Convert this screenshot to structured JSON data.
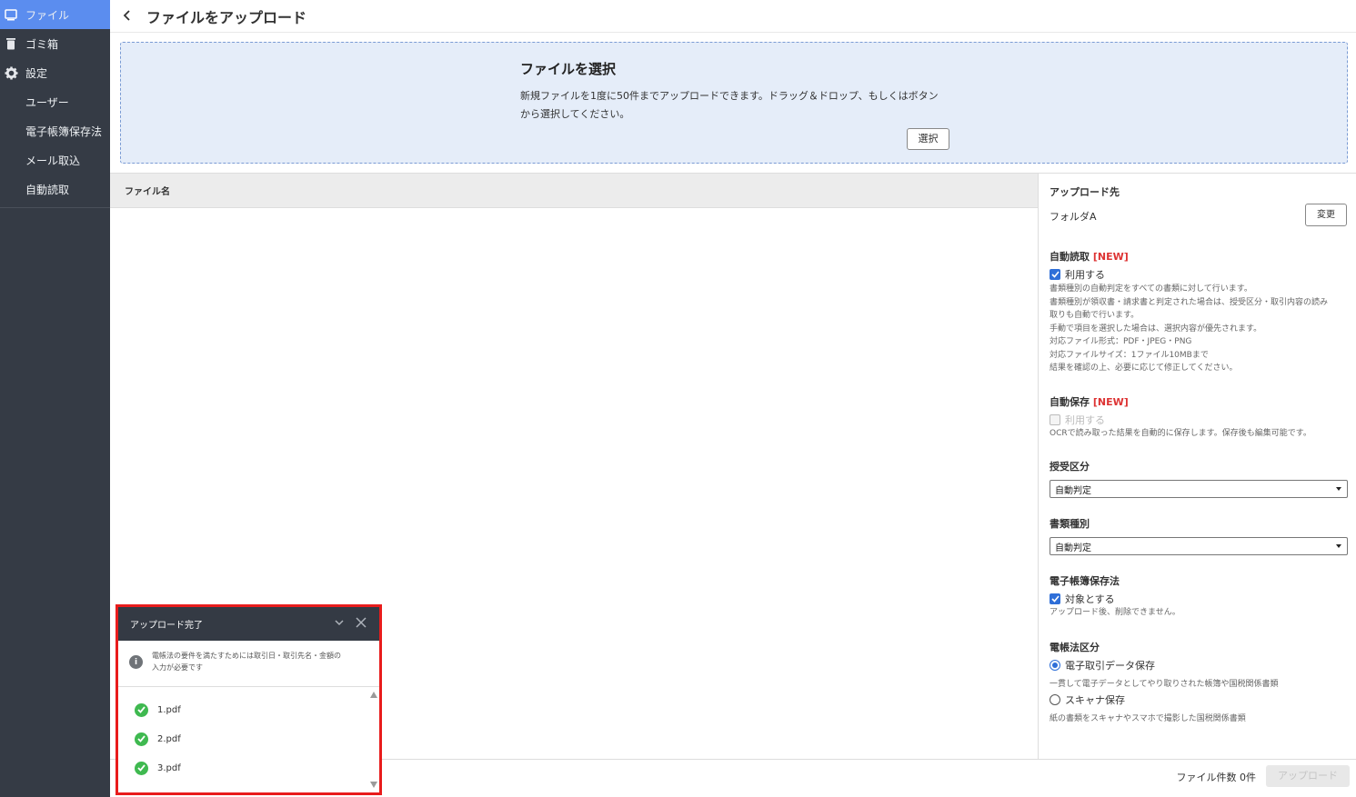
{
  "sidebar": {
    "items": [
      {
        "label": "ファイル",
        "icon": "monitor-icon",
        "active": true
      },
      {
        "label": "ゴミ箱",
        "icon": "trash-icon"
      },
      {
        "label": "設定",
        "icon": "gear-icon"
      },
      {
        "label": "ユーザー"
      },
      {
        "label": "電子帳簿保存法"
      },
      {
        "label": "メール取込"
      },
      {
        "label": "自動読取"
      }
    ]
  },
  "header": {
    "title": "ファイルをアップロード",
    "back_icon": "chevron-left-icon"
  },
  "dropzone": {
    "title": "ファイルを選択",
    "desc_line1": "新規ファイルを1度に50件までアップロードできます。ドラッグ＆ドロップ、もしくはボタン",
    "desc_line2": "から選択してください。",
    "select_label": "選択"
  },
  "table": {
    "column_filename": "ファイル名"
  },
  "panel": {
    "upload_dest_title": "アップロード先",
    "upload_dest_value": "フォルダA",
    "change_label": "変更",
    "auto_read": {
      "title": "自動読取",
      "new_tag": "[NEW]",
      "checkbox_label": "利用する",
      "checked": true,
      "notes": [
        "書類種別の自動判定をすべての書類に対して行います。",
        "書類種別が領収書・請求書と判定された場合は、授受区分・取引内容の読み",
        "取りも自動で行います。",
        "手動で項目を選択した場合は、選択内容が優先されます。",
        "対応ファイル形式：PDF・JPEG・PNG",
        "対応ファイルサイズ：1ファイル10MBまで",
        "結果を確認の上、必要に応じて修正してください。"
      ]
    },
    "auto_save": {
      "title": "自動保存",
      "new_tag": "[NEW]",
      "checkbox_label": "利用する",
      "checked": false,
      "note": "OCRで読み取った結果を自動的に保存します。保存後も編集可能です。"
    },
    "transfer_type": {
      "title": "授受区分",
      "value": "自動判定"
    },
    "doc_type": {
      "title": "書類種別",
      "value": "自動判定"
    },
    "ebook_law": {
      "title": "電子帳簿保存法",
      "checkbox_label": "対象とする",
      "checked": true,
      "note": "アップロード後、削除できません。"
    },
    "law_category": {
      "title": "電帳法区分",
      "options": [
        {
          "label": "電子取引データ保存",
          "note": "一貫して電子データとしてやり取りされた帳簿や国税関係書類",
          "selected": true
        },
        {
          "label": "スキャナ保存",
          "note": "紙の書類をスキャナやスマホで撮影した国税関係書類",
          "selected": false
        }
      ]
    }
  },
  "footer": {
    "file_count": "ファイル件数 0件",
    "upload_label": "アップロード"
  },
  "toast": {
    "title": "アップロード完了",
    "info_line1": "電帳法の要件を満たすためには取引日・取引先名・金額の",
    "info_line2": "入力が必要です",
    "files": [
      "1.pdf",
      "2.pdf",
      "3.pdf"
    ]
  },
  "colors": {
    "accent": "#2f6fd8",
    "sidebar_bg": "#353b45",
    "active_nav": "#5b8def",
    "new_tag": "#d33333",
    "highlight_border": "#e81c1c",
    "success": "#3fb950"
  }
}
